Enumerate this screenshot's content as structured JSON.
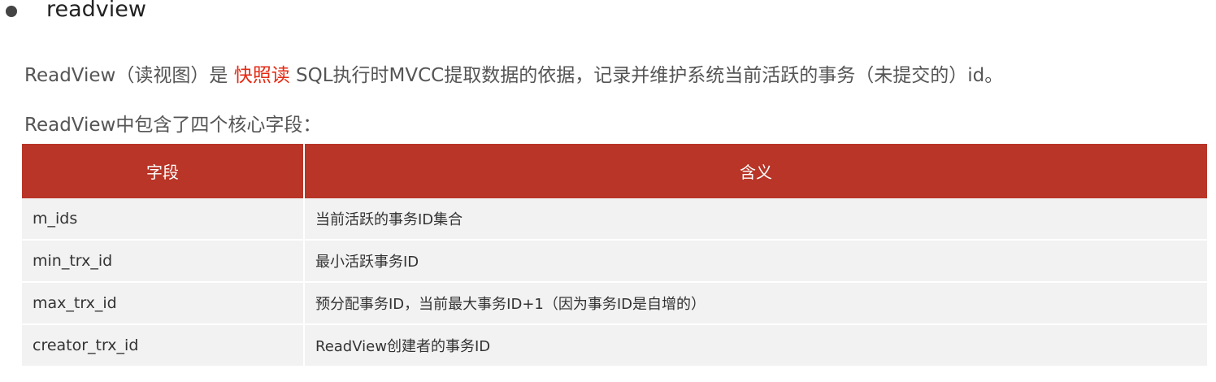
{
  "heading": "readview",
  "intro": {
    "prefix": "ReadView（读视图）是 ",
    "highlight": "快照读",
    "suffix": " SQL执行时MVCC提取数据的依据，记录并维护系统当前活跃的事务（未提交的）id。"
  },
  "subtitle": "ReadView中包含了四个核心字段：",
  "table": {
    "headers": [
      "字段",
      "含义"
    ],
    "rows": [
      {
        "field": "m_ids",
        "meaning": "当前活跃的事务ID集合"
      },
      {
        "field": "min_trx_id",
        "meaning": "最小活跃事务ID"
      },
      {
        "field": "max_trx_id",
        "meaning": "预分配事务ID，当前最大事务ID+1（因为事务ID是自增的）"
      },
      {
        "field": "creator_trx_id",
        "meaning": "ReadView创建者的事务ID"
      }
    ]
  },
  "colors": {
    "header_bg": "#b83527",
    "highlight": "#e32b15",
    "row_bg": "#f2f2f2"
  }
}
